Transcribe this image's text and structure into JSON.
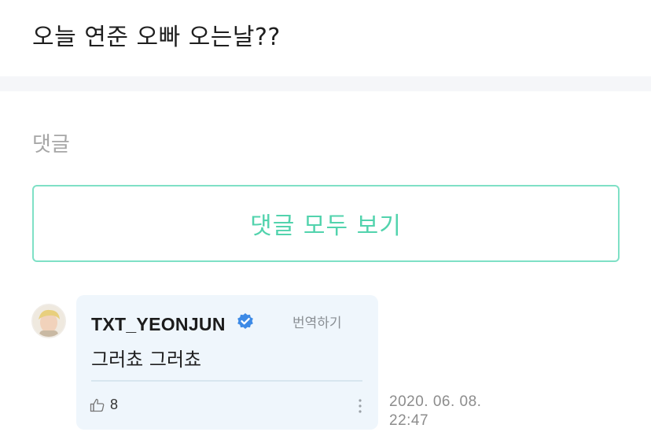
{
  "post": {
    "text": "오늘 연준 오빠 오는날??"
  },
  "comments_section": {
    "heading": "댓글",
    "view_all_label": "댓글 모두 보기"
  },
  "comment": {
    "author": "TXT_YEONJUN",
    "verified": true,
    "translate_label": "번역하기",
    "text": "그러쵸 그러쵸",
    "likes": "8",
    "date_line": "2020. 06. 08.",
    "time_line": "22:47"
  },
  "colors": {
    "accent": "#52d3ad",
    "accent_border": "#7fe0c6",
    "bubble_bg": "#eff6fc",
    "verified_blue": "#3d8ae6"
  },
  "icons": {
    "verified": "verified-badge-icon",
    "like": "thumbs-up-icon",
    "more": "more-vertical-icon"
  }
}
